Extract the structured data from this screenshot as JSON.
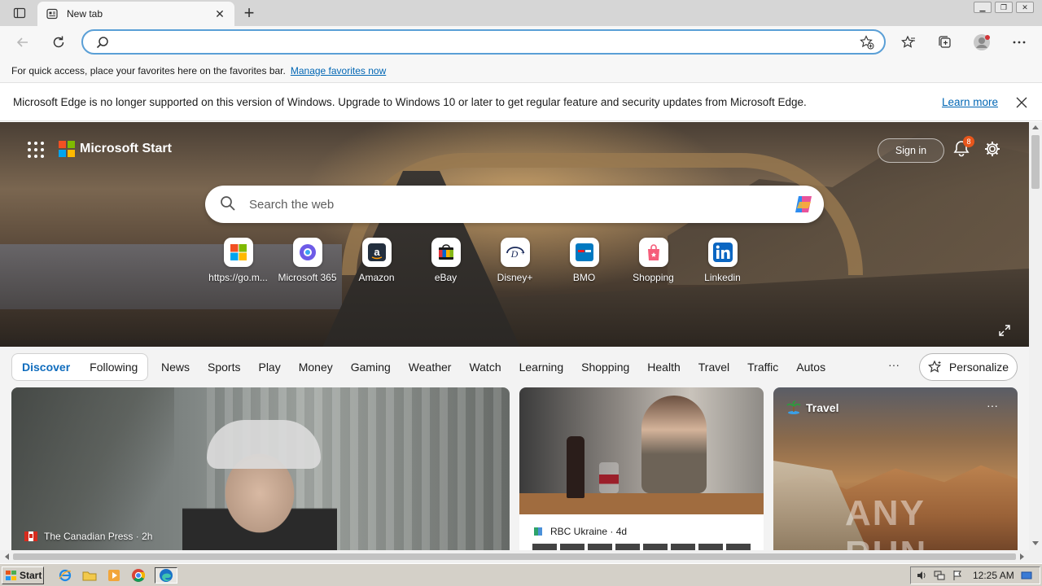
{
  "browser": {
    "tab": {
      "title": "New tab"
    },
    "address": {
      "value": "",
      "placeholder": ""
    }
  },
  "favorites_bar": {
    "message": "For quick access, place your favorites here on the favorites bar.",
    "link": "Manage favorites now"
  },
  "infobar": {
    "message": "Microsoft Edge is no longer supported on this version of Windows. Upgrade to Windows 10 or later to get regular feature and security updates from Microsoft Edge.",
    "link": "Learn more"
  },
  "start_page": {
    "brand": "Microsoft Start",
    "sign_in": "Sign in",
    "notification_count": "8",
    "search_placeholder": "Search the web",
    "quick_links": [
      {
        "label": "https://go.m...",
        "icon": "microsoft-logo-icon"
      },
      {
        "label": "Microsoft 365",
        "icon": "microsoft-365-icon"
      },
      {
        "label": "Amazon",
        "icon": "amazon-icon"
      },
      {
        "label": "eBay",
        "icon": "ebay-icon"
      },
      {
        "label": "Disney+",
        "icon": "disney-plus-icon"
      },
      {
        "label": "BMO",
        "icon": "bmo-icon"
      },
      {
        "label": "Shopping",
        "icon": "shopping-bag-icon"
      },
      {
        "label": "Linkedin",
        "icon": "linkedin-icon"
      }
    ],
    "feed_tabs": [
      "Discover",
      "Following"
    ],
    "active_feed_tab": "Discover",
    "categories": [
      "News",
      "Sports",
      "Play",
      "Money",
      "Gaming",
      "Weather",
      "Watch",
      "Learning",
      "Shopping",
      "Health",
      "Travel",
      "Traffic",
      "Autos"
    ],
    "more": "···",
    "personalize": "Personalize",
    "cards": [
      {
        "source": "The Canadian Press",
        "age": "2h"
      },
      {
        "source": "RBC Ukraine",
        "age": "4d"
      },
      {
        "label": "Travel",
        "more": "···"
      }
    ],
    "watermark": "ANY RUN"
  },
  "taskbar": {
    "start": "Start",
    "clock": "12:25 AM"
  },
  "colors": {
    "accent": "#0f6cbd",
    "link": "#0066b4",
    "address_focus": "#5a9fd6",
    "notification_badge": "#e8561b"
  }
}
